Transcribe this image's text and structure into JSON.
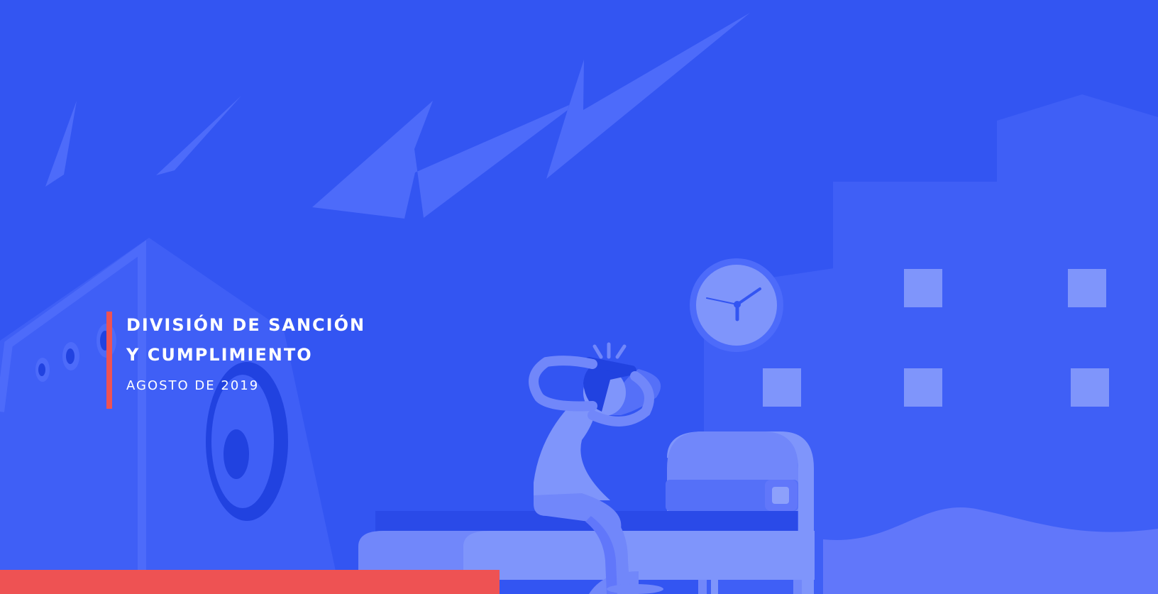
{
  "cover": {
    "title_line_1": "DIVISIÓN DE SANCIÓN",
    "title_line_2": "Y CUMPLIMIENTO",
    "date": "AGOSTO DE 2019"
  },
  "colors": {
    "background": "#3355f2",
    "accent_red": "#ee5253",
    "light_shape": "#4d6bfa",
    "pale_shape": "#7f95fb",
    "dark_shape": "#2142e0"
  }
}
